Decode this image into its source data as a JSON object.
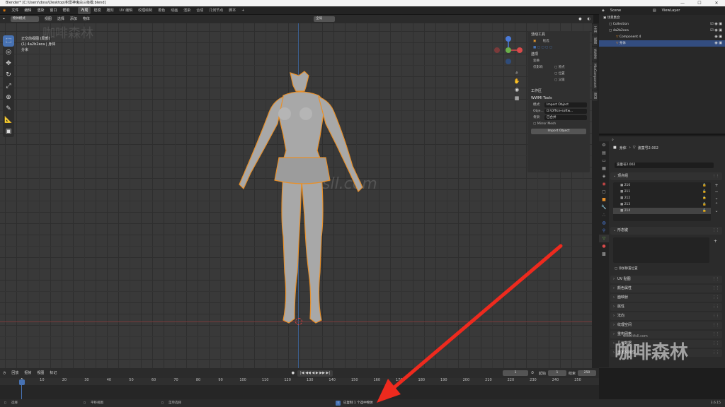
{
  "window": {
    "title": "Blender* [C:\\Users\\dosu\\Desktop\\积雷神鬼白三级模.blend]"
  },
  "menu": [
    "文件",
    "编辑",
    "渲染",
    "窗口",
    "帮助"
  ],
  "workspaces": [
    "布局",
    "建模",
    "雕刻",
    "UV 编辑",
    "纹理绘制",
    "着色",
    "动画",
    "渲染",
    "合成",
    "几何节点",
    "脚本"
  ],
  "scene": {
    "name": "Scene",
    "view_layer": "ViewLayer"
  },
  "viewport_header": {
    "mode": "物体模式",
    "menus": [
      "视图",
      "选择",
      "添加",
      "物体"
    ],
    "transform": "全局",
    "options_label": "选项"
  },
  "viewport_info": {
    "line1": "正交前视图 (局部)",
    "line2": "(1) 4a2b2eca | 身体",
    "line3": "分米"
  },
  "watermarks": {
    "site": "tktsll.com",
    "brand": "咖啡森林",
    "site2": "www.tfsll.com"
  },
  "npanel": {
    "active_tool": "活动工具",
    "tool_name": "框选",
    "options": "选项",
    "transform": "变换",
    "affect_only": "仅影响",
    "checks": [
      "原点",
      "位置",
      "父级"
    ],
    "workspace": "工作区",
    "wwmi_title": "WWMI Tools",
    "mode_label": "模式:",
    "mode_value": "Import Object",
    "object_label": "Obje...",
    "object_value": "D:\\Office-softw...",
    "skeleton_label": "骨架:",
    "skeleton_value": "已合并",
    "mirror_mesh": "Mirror Mesh",
    "import_button": "Import Object"
  },
  "sidebar_tabs": [
    "工具",
    "视图",
    "WWMI",
    "MioComponent",
    "项目"
  ],
  "outliner": {
    "root": "场景集合",
    "items": [
      {
        "name": "Collection",
        "indent": 1
      },
      {
        "name": "4a2b2eca",
        "indent": 1
      },
      {
        "name": "Component 4",
        "indent": 2
      },
      {
        "name": "身体",
        "indent": 2,
        "selected": true
      }
    ]
  },
  "properties": {
    "breadcrumb_object": "身体",
    "breadcrumb_mesh": "波童号2.002",
    "mesh_name": "波童号2.002",
    "vertex_groups_title": "顶点组",
    "uv_items": [
      "210",
      "211",
      "212",
      "213",
      "214"
    ],
    "shape_keys_title": "形态键",
    "add_rest_position": "添加静置位置",
    "sections": [
      "UV 贴图",
      "颜色属性",
      "面映射",
      "属性",
      "法向",
      "纹理空间",
      "重构网格",
      "几何数据",
      "自定义属性"
    ]
  },
  "timeline": {
    "menus": [
      "回放",
      "抠帧",
      "视图",
      "标记"
    ],
    "current_frame": "1",
    "start_label": "起始",
    "start": "1",
    "end_label": "结束",
    "end": "250",
    "ticks": [
      "1",
      "10",
      "20",
      "30",
      "40",
      "50",
      "60",
      "70",
      "80",
      "90",
      "100",
      "110",
      "120",
      "130",
      "140",
      "150",
      "160",
      "170",
      "180",
      "190",
      "200",
      "210",
      "220",
      "230",
      "240",
      "250"
    ]
  },
  "status": {
    "select": "选择",
    "pan": "平移视图",
    "context_menu": "菜单选择",
    "message": "已复制 1 个选中物体",
    "version": "3.6.15"
  },
  "colors": {
    "accent": "#4772b3",
    "selection_outline": "#e8902a",
    "arrow": "#ee2a1e"
  }
}
